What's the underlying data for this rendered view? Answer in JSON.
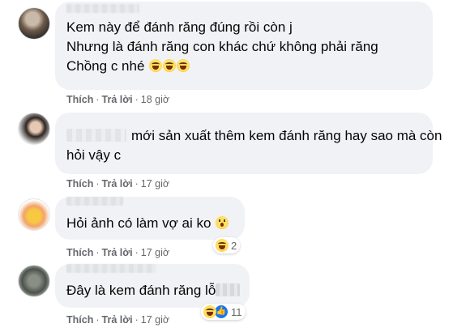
{
  "comments": [
    {
      "lines": [
        "Kem này để đánh răng đúng rồi còn j",
        "Nhưng là đánh răng con khác chứ không phải răng",
        "Chồng c nhé"
      ],
      "emoji_count": 3,
      "like": "Thích",
      "reply": "Trả lời",
      "time": "18 giờ"
    },
    {
      "lines": [
        "mới sản xuất thêm kem đánh răng hay sao mà còn",
        "hỏi vậy c"
      ],
      "like": "Thích",
      "reply": "Trả lời",
      "time": "17 giờ"
    },
    {
      "lines": [
        "Hỏi ảnh có làm vợ ai ko"
      ],
      "like": "Thích",
      "reply": "Trả lời",
      "time": "17 giờ",
      "reaction_count": "2"
    },
    {
      "lines": [
        "Đây là kem đánh răng lỗ"
      ],
      "like": "Thích",
      "reply": "Trả lời",
      "time": "17 giờ",
      "reaction_count": "11"
    }
  ],
  "icons": {
    "laugh": "laugh-emoji-icon",
    "wow": "wow-emoji-icon",
    "like": "like-icon"
  }
}
